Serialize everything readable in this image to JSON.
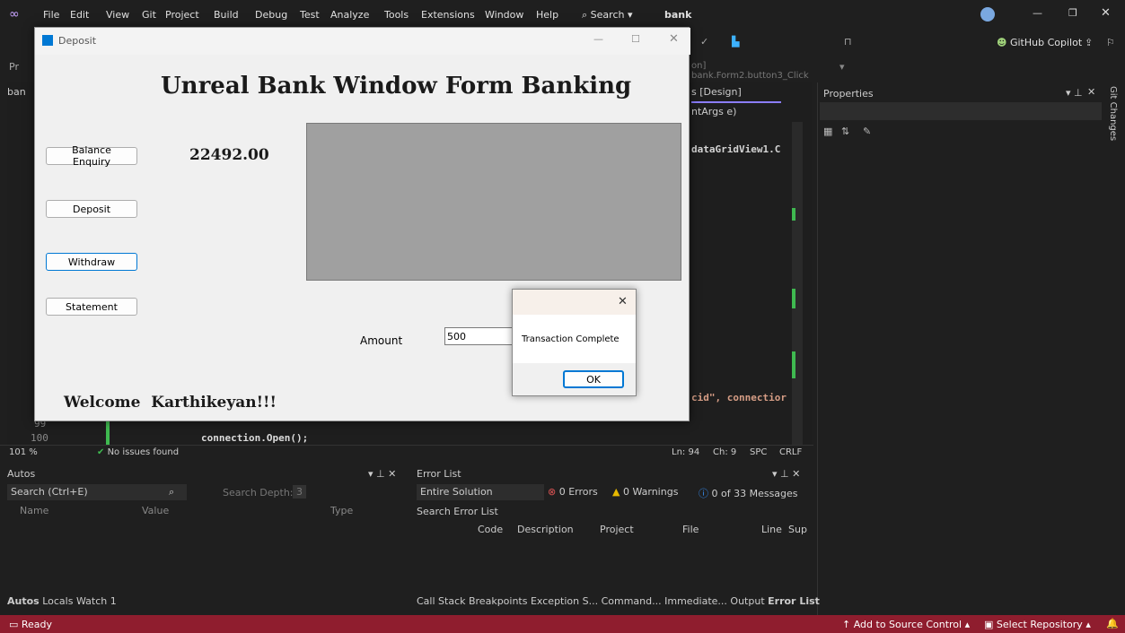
{
  "menubar": {
    "items": [
      "File",
      "Edit",
      "View",
      "Git",
      "Project",
      "Build",
      "Debug",
      "Test",
      "Analyze",
      "Tools",
      "Extensions",
      "Window",
      "Help"
    ],
    "search_label": "Search",
    "solution_name": "bank",
    "copilot_label": "GitHub Copilot"
  },
  "toolbar2": {
    "navigation_text": "on] bank.Form2.button3_Click"
  },
  "editor": {
    "design_tab": "s [Design]",
    "member_dropdown": "ntArgs e)",
    "code_fragment_1": "dataGridView1.C",
    "code_fragment_2": "cid\", connectior",
    "line_99": "99",
    "line_100": "100",
    "code_line_100": "connection.Open();",
    "tab_left_fragment": "ban"
  },
  "editor_status": {
    "zoom": "101 %",
    "issues": "No issues found",
    "ln": "Ln: 94",
    "ch": "Ch: 9",
    "spc": "SPC",
    "crlf": "CRLF"
  },
  "properties": {
    "title": "Properties"
  },
  "git_changes": {
    "label": "Git Changes"
  },
  "autos": {
    "title": "Autos",
    "search_placeholder": "Search (Ctrl+E)",
    "search_depth_label": "Search Depth:",
    "search_depth_value": "3",
    "columns": [
      "Name",
      "Value",
      "Type"
    ],
    "tabs": [
      "Autos",
      "Locals",
      "Watch 1"
    ]
  },
  "error_list": {
    "title": "Error List",
    "scope": "Entire Solution",
    "errors": "0 Errors",
    "warnings": "0 Warnings",
    "messages": "0 of 33 Messages",
    "search_placeholder": "Search Error List",
    "columns": [
      "Code",
      "Description",
      "Project",
      "File",
      "Line",
      "Sup"
    ],
    "tabs": [
      "Call Stack",
      "Breakpoints",
      "Exception S...",
      "Command...",
      "Immediate...",
      "Output",
      "Error List"
    ]
  },
  "statusbar": {
    "ready": "Ready",
    "add_source": "Add to Source Control",
    "select_repo": "Select Repository"
  },
  "deposit_form": {
    "window_title": "Deposit",
    "heading": "Unreal Bank Window Form Banking",
    "balance": "22492.00",
    "buttons": {
      "balance_enquiry": "Balance Enquiry",
      "deposit": "Deposit",
      "withdraw": "Withdraw",
      "statement": "Statement"
    },
    "amount_label": "Amount",
    "amount_value": "500",
    "welcome": "Welcome  Karthikeyan!!!"
  },
  "message_box": {
    "text": "Transaction Complete",
    "ok_label": "OK"
  },
  "colors": {
    "statusbar": "#8f1d2e",
    "ide_background": "#1f1f1f",
    "form_background": "#f0f0f0",
    "grid_placeholder": "#a0a0a0",
    "accent_blue": "#0078d4"
  }
}
